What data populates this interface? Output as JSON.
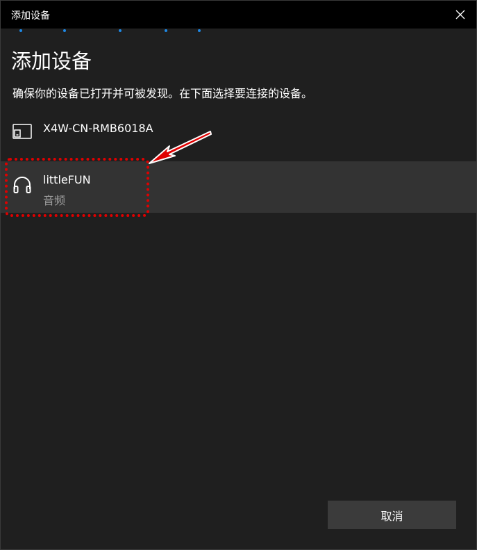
{
  "window": {
    "title": "添加设备",
    "close_icon": "close-icon"
  },
  "content": {
    "heading": "添加设备",
    "instruction": "确保你的设备已打开并可被发现。在下面选择要连接的设备。"
  },
  "devices": [
    {
      "name": "X4W-CN-RMB6018A",
      "type": "",
      "icon": "display-device-icon"
    },
    {
      "name": "littleFUN",
      "type": "音频",
      "icon": "headphones-icon"
    }
  ],
  "footer": {
    "cancel_label": "取消"
  },
  "colors": {
    "accent": "#1e88e5",
    "annotation": "#e00000",
    "selected_row": "#333333",
    "background": "#1f1f1f",
    "titlebar": "#000000"
  }
}
